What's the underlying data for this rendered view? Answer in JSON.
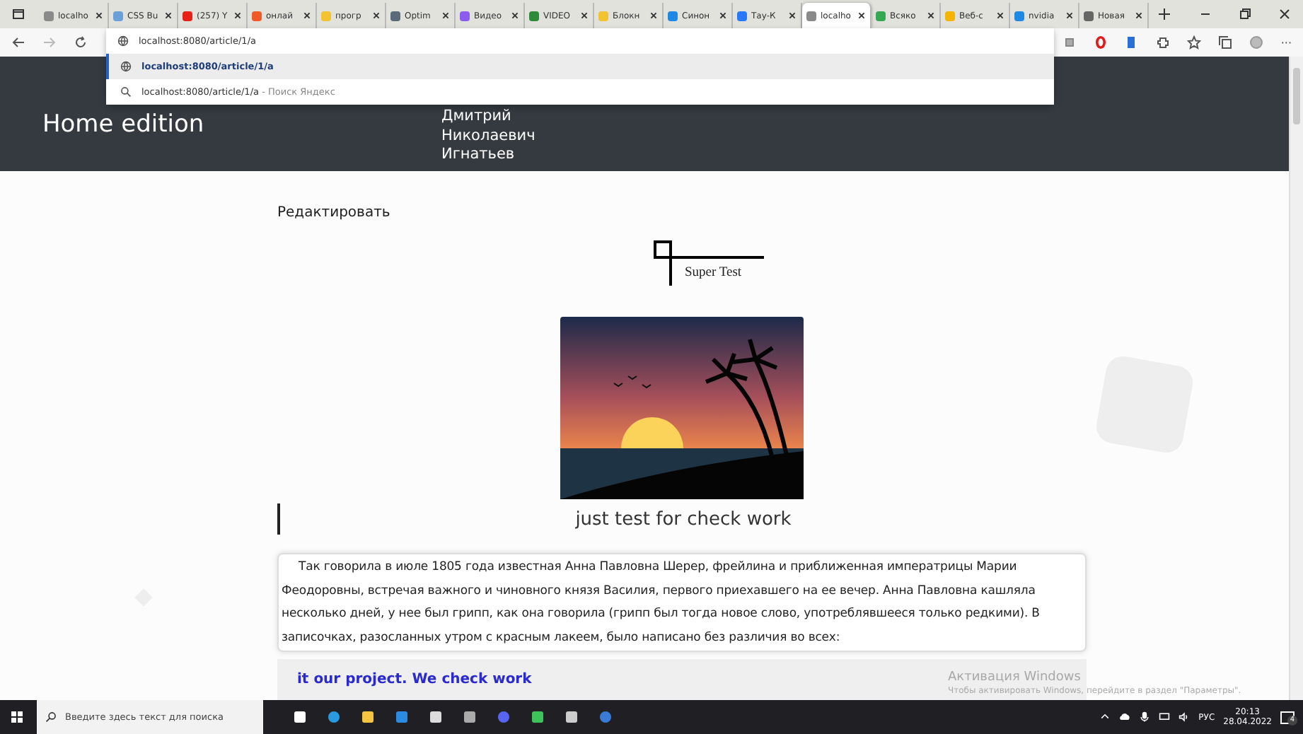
{
  "browser": {
    "tabs": [
      {
        "label": "localho",
        "color": "#8a8a8a",
        "selected": false
      },
      {
        "label": "CSS Bu",
        "color": "#6aa0d8",
        "selected": false
      },
      {
        "label": "(257) Y",
        "color": "#e62117",
        "selected": false
      },
      {
        "label": "онлай",
        "color": "#f05a28",
        "selected": false
      },
      {
        "label": "прогр",
        "color": "#f2c230",
        "selected": false
      },
      {
        "label": "Optim",
        "color": "#5a6a7a",
        "selected": false
      },
      {
        "label": "Видео",
        "color": "#8a5cf0",
        "selected": false
      },
      {
        "label": "VIDEO",
        "color": "#2e8b3a",
        "selected": false
      },
      {
        "label": "Блокн",
        "color": "#f2c230",
        "selected": false
      },
      {
        "label": "Синон",
        "color": "#1e88e5",
        "selected": false
      },
      {
        "label": "Тау-К",
        "color": "#2979ff",
        "selected": false
      },
      {
        "label": "localho",
        "color": "#8a8a8a",
        "selected": true
      },
      {
        "label": "Всяко",
        "color": "#34a853",
        "selected": false
      },
      {
        "label": "Веб-с",
        "color": "#f4b400",
        "selected": false
      },
      {
        "label": "nvidia",
        "color": "#1e88e5",
        "selected": false
      },
      {
        "label": "Новая",
        "color": "#666666",
        "selected": false
      }
    ],
    "address": {
      "value": "localhost:8080/article/1/a"
    },
    "suggestions": [
      {
        "kind": "url",
        "text": "localhost:8080/article/1/a",
        "selected": true
      },
      {
        "kind": "search",
        "text": "localhost:8080/article/1/a",
        "hint": "- Поиск Яндекс",
        "selected": false
      }
    ],
    "more_label": "···"
  },
  "page": {
    "brand": "Home edition",
    "author_lines": [
      "Дмитрий",
      "Николаевич",
      "Игнатьев"
    ],
    "edit_link": "Редактировать",
    "diagram_label": "Super Test",
    "caption": "just test for check work",
    "paragraph": "Так говорила в июле 1805 года известная Анна Павловна Шерер, фрейлина и приближенная императрицы Марии Феодоровны, встречая важного и чиновного князя Василия, первого приехавшего на ее вечер. Анна Павловна кашляла несколько дней, у нее был грипп, как она говорила (грипп был тогда новое слово, употреблявшееся только редкими). В записочках, разосланных утром с красным лакеем, было написано без различия во всех:",
    "footer_text": "it our project. We check work"
  },
  "activation": {
    "title": "Активация Windows",
    "subtitle": "Чтобы активировать Windows, перейдите в раздел \"Параметры\"."
  },
  "taskbar": {
    "search_placeholder": "Введите здесь текст для поиска",
    "language": "РУС",
    "time": "20:13",
    "date": "28.04.2022",
    "notifications": "4"
  }
}
